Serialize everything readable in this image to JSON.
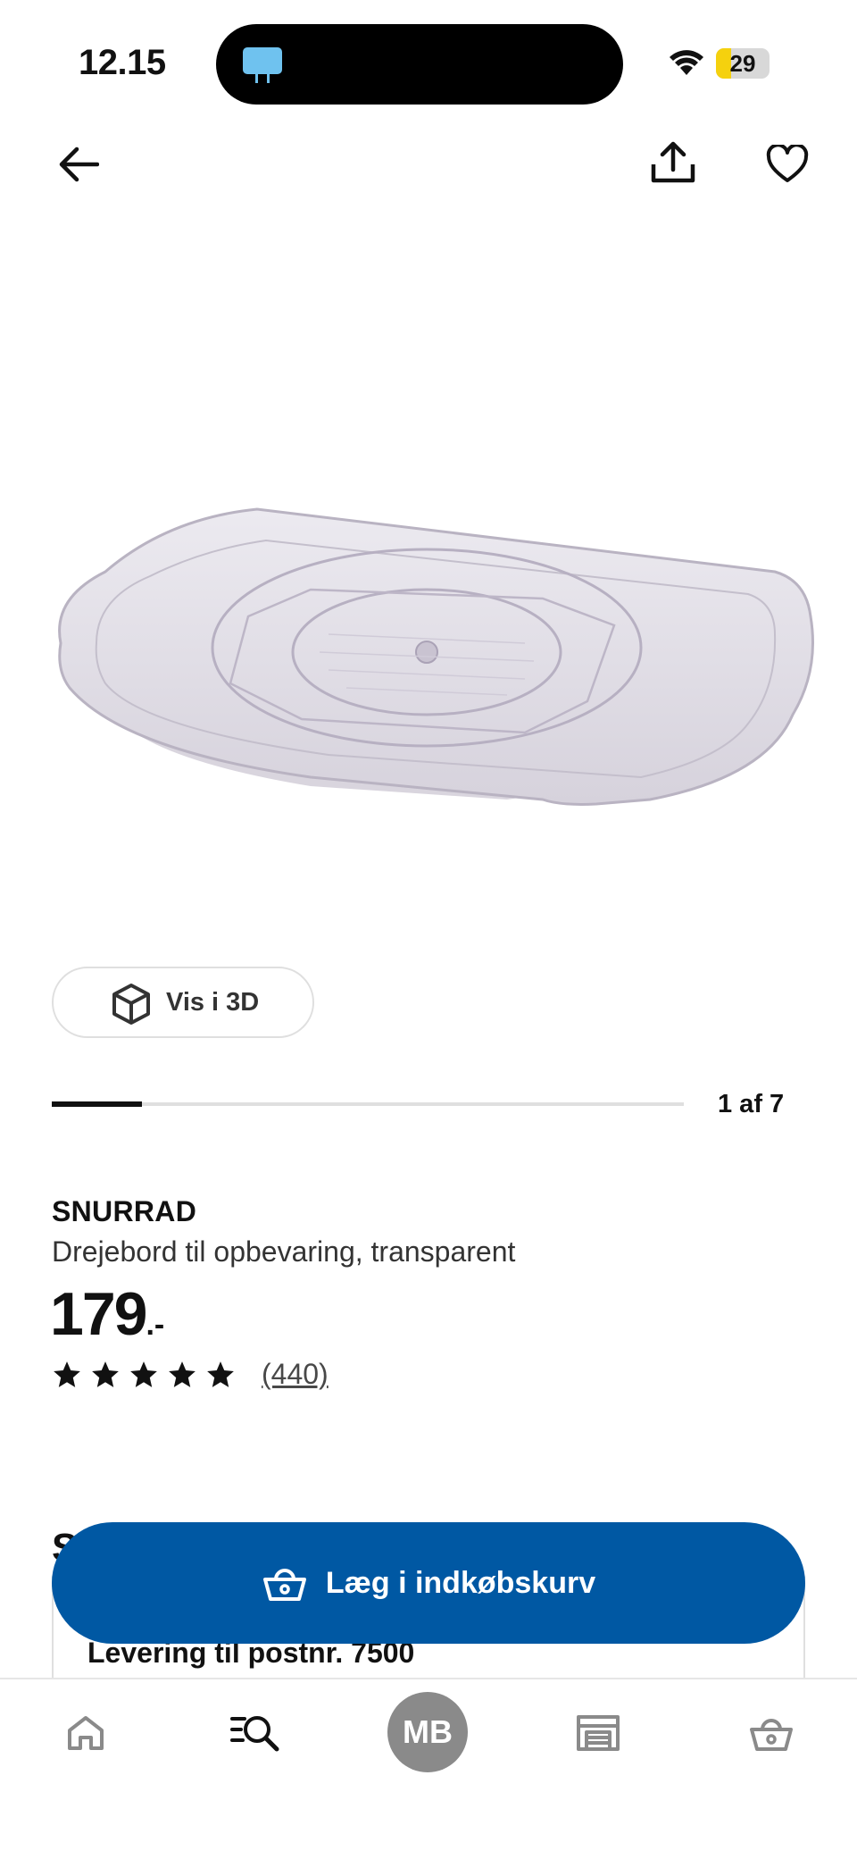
{
  "status_bar": {
    "time": "12.15",
    "battery": "29",
    "battery_level": 0.29,
    "island_icon": "tv-icon"
  },
  "nav": {
    "back_icon": "arrow-left-icon",
    "share_icon": "share-icon",
    "favorite_icon": "heart-icon"
  },
  "gallery": {
    "view3d_label": "Vis i 3D",
    "position_label": "1 af 7",
    "current": 1,
    "total": 7
  },
  "product": {
    "name": "SNURRAD",
    "description": "Drejebord til opbevaring, transparent",
    "price": "179",
    "price_suffix": ".-",
    "rating": 5,
    "review_count": "(440)"
  },
  "section": {
    "peek_text": "S",
    "delivery_text": "Levering til postnr. 7500"
  },
  "cta": {
    "label": "Læg i indkøbskurv",
    "icon": "basket-icon",
    "color": "#0058a3"
  },
  "tabbar": {
    "profile_initials": "MB",
    "items": [
      "home-icon",
      "search-icon",
      "profile-avatar",
      "store-icon",
      "basket-icon"
    ]
  }
}
